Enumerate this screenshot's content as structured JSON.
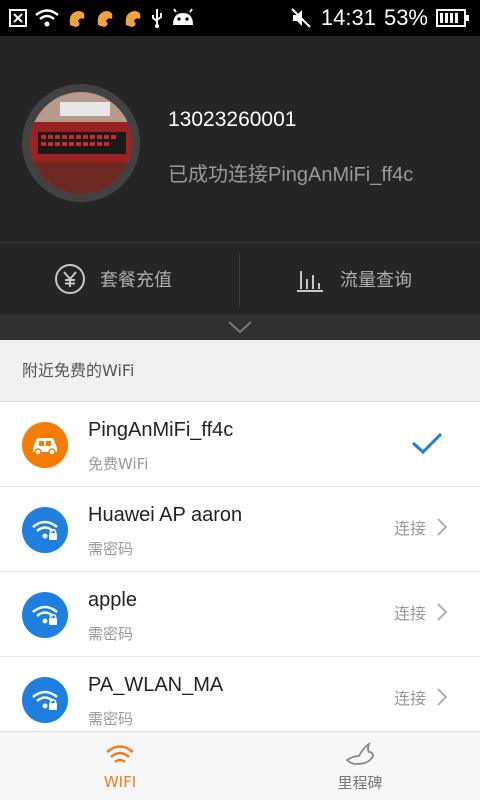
{
  "status_bar": {
    "icons_left": [
      "close-box-icon",
      "wifi-icon",
      "squirrel-icon",
      "squirrel-icon",
      "squirrel-icon",
      "usb-icon",
      "android-icon"
    ],
    "icons_right": [
      "mute-icon",
      "battery-icon"
    ],
    "time": "14:31",
    "battery": "53%"
  },
  "profile": {
    "phone": "13023260001",
    "status": "已成功连接PingAnMiFi_ff4c"
  },
  "actions": [
    {
      "label": "套餐充值",
      "icon": "yen-icon"
    },
    {
      "label": "流量查询",
      "icon": "bar-chart-icon"
    }
  ],
  "section_title": "附近免费的WiFi",
  "networks": [
    {
      "name": "PingAnMiFi_ff4c",
      "sub": "免费WiFi",
      "icon": "car-icon",
      "icon_color": "#f57c00",
      "state": "connected"
    },
    {
      "name": "Huawei AP aaron",
      "sub": "需密码",
      "icon": "wifi-lock-icon",
      "icon_color": "#1e7fe0",
      "action": "连接"
    },
    {
      "name": "apple",
      "sub": "需密码",
      "icon": "wifi-lock-icon",
      "icon_color": "#1e7fe0",
      "action": "连接"
    },
    {
      "name": "PA_WLAN_MA",
      "sub": "需密码",
      "icon": "wifi-lock-icon",
      "icon_color": "#1e7fe0",
      "action": "连接"
    }
  ],
  "tabs": [
    {
      "label": "WIFI",
      "active": true,
      "color": "#f07b1a"
    },
    {
      "label": "里程碑",
      "active": false,
      "color": "#777777"
    }
  ]
}
